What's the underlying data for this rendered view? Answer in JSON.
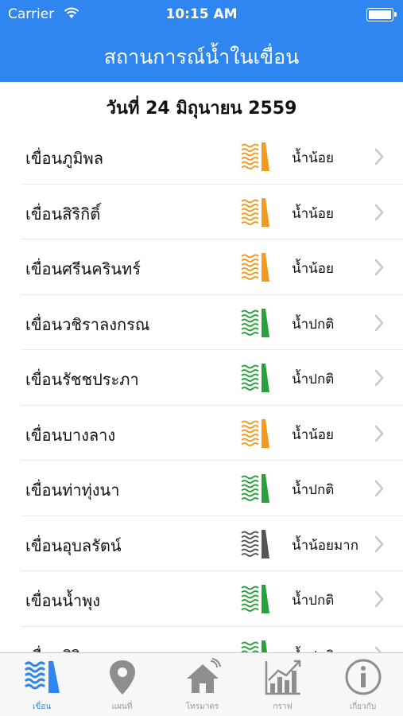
{
  "status_bar": {
    "carrier": "Carrier",
    "time": "10:15 AM"
  },
  "header": {
    "title": "สถานการณ์น้ำในเขื่อน"
  },
  "date": "วันที่ 24 มิถุนายน 2559",
  "colors": {
    "primary": "#2f86f0",
    "low": "#f39a1f",
    "normal": "#27a23a",
    "very_low": "#555555"
  },
  "dams": [
    {
      "name": "เขื่อนภูมิพล",
      "status": "น้ำน้อย",
      "level": "low"
    },
    {
      "name": "เขื่อนสิริกิติ์",
      "status": "น้ำน้อย",
      "level": "low"
    },
    {
      "name": "เขื่อนศรีนครินทร์",
      "status": "น้ำน้อย",
      "level": "low"
    },
    {
      "name": "เขื่อนวชิราลงกรณ",
      "status": "น้ำปกติ",
      "level": "normal"
    },
    {
      "name": "เขื่อนรัชชประภา",
      "status": "น้ำปกติ",
      "level": "normal"
    },
    {
      "name": "เขื่อนบางลาง",
      "status": "น้ำน้อย",
      "level": "low"
    },
    {
      "name": "เขื่อนท่าทุ่งนา",
      "status": "น้ำปกติ",
      "level": "normal"
    },
    {
      "name": "เขื่อนอุบลรัตน์",
      "status": "น้ำน้อยมาก",
      "level": "very_low"
    },
    {
      "name": "เขื่อนน้ำพุง",
      "status": "น้ำปกติ",
      "level": "normal"
    },
    {
      "name": "เขื่อนสิรินธร",
      "status": "น้ำปกติ",
      "level": "normal"
    }
  ],
  "tabs": [
    {
      "label": "เขื่อน",
      "icon": "dam-icon",
      "active": true
    },
    {
      "label": "แผนที่",
      "icon": "map-pin-icon",
      "active": false
    },
    {
      "label": "โทรมาตร",
      "icon": "telemetry-house-icon",
      "active": false
    },
    {
      "label": "กราฟ",
      "icon": "graph-icon",
      "active": false
    },
    {
      "label": "เกี่ยวกับ",
      "icon": "info-icon",
      "active": false
    }
  ]
}
